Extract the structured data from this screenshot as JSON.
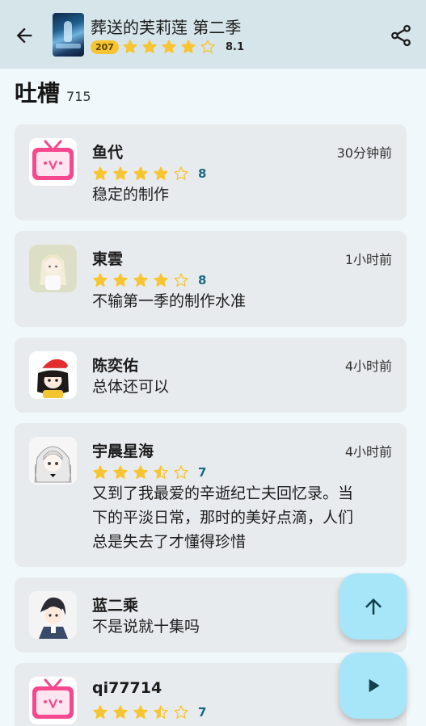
{
  "header": {
    "title": "葬送的芙莉莲 第二季",
    "rank": "207",
    "rating": "8.1",
    "stars": 4,
    "icons": {
      "back": "arrow-left-icon",
      "share": "share-icon",
      "poster": "anime-poster"
    }
  },
  "section": {
    "title": "吐槽",
    "count": "715"
  },
  "comments": [
    {
      "user": "鱼代",
      "time": "30分钟前",
      "stars": 4,
      "score": "8",
      "text": "稳定的制作",
      "avatar": "bilibili-tv-avatar"
    },
    {
      "user": "東雲",
      "time": "1小时前",
      "stars": 4,
      "score": "8",
      "text": "不输第一季的制作水准",
      "avatar": "anime-girl-avatar"
    },
    {
      "user": "陈奕佑",
      "time": "4小时前",
      "text": "总体还可以",
      "avatar": "santa-hat-girl-avatar"
    },
    {
      "user": "宇晨星海",
      "time": "4小时前",
      "stars": 3.5,
      "score": "7",
      "text_lines": [
        "又到了我最爱的辛逝纪亡夫回忆录。当",
        "下的平淡日常，那时的美好点滴，人们",
        "总是失去了才懂得珍惜"
      ],
      "avatar": "white-hair-girl-avatar"
    },
    {
      "user": "蓝二乘",
      "time": "",
      "text": "不是说就十集吗",
      "avatar": "anime-boy-avatar"
    },
    {
      "user": "qi77714",
      "time": "",
      "stars": 3.5,
      "score": "7",
      "avatar": "bilibili-tv-avatar"
    }
  ],
  "fabs": {
    "scroll_top": "arrow-up-icon",
    "play": "play-icon"
  },
  "colors": {
    "star": "#f7c531",
    "score": "#1b6b80",
    "fab": "#a6e6f8",
    "card": "#e8ebed",
    "topbar": "#d6e5ea"
  }
}
